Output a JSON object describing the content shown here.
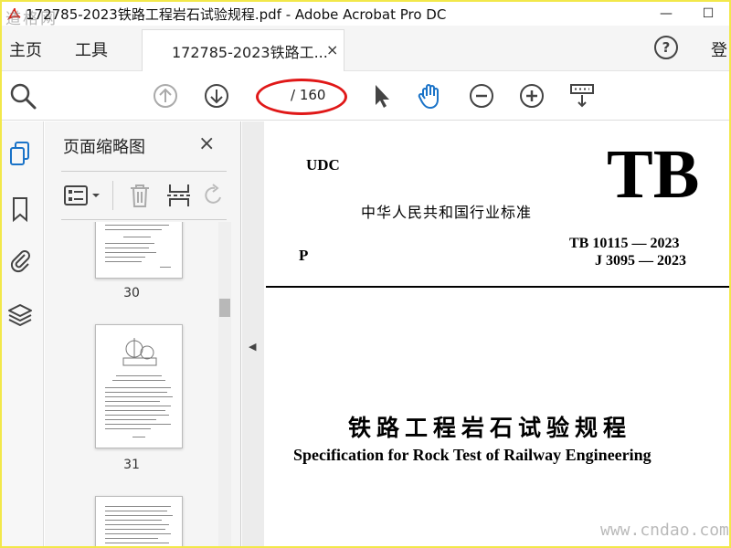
{
  "window": {
    "title": "172785-2023铁路工程岩石试验规程.pdf - Adobe Acrobat Pro DC",
    "watermark_top": "道格网",
    "minimize": "—",
    "maximize": "☐"
  },
  "menubar": {
    "home": "主页",
    "tools": "工具",
    "tab_label": "172785-2023铁路工...",
    "tab_close": "×",
    "help": "?",
    "login": "登"
  },
  "toolbar": {
    "page_current": "",
    "page_total": "/ 160",
    "icons": [
      "search-icon",
      "page-up-icon",
      "page-down-icon",
      "select-arrow-icon",
      "hand-tool-icon",
      "zoom-out-icon",
      "zoom-in-icon",
      "scroll-mode-icon"
    ]
  },
  "thumbnail_panel": {
    "title": "页面缩略图",
    "close": "×",
    "pages": [
      {
        "number": "30"
      },
      {
        "number": "31"
      },
      {
        "number": ""
      }
    ]
  },
  "document": {
    "udc": "UDC",
    "tb": "TB",
    "standard_name": "中华人民共和国行业标准",
    "p_label": "P",
    "code_tb": "TB 10115 — 2023",
    "code_j": "J 3095 — 2023",
    "title_cn": "铁路工程岩石试验规程",
    "title_en": "Specification for Rock Test of Railway Engineering"
  },
  "watermark_bottom": "www.cndao.com",
  "colors": {
    "accent_blue": "#1a73c8",
    "highlight_red": "#e01818",
    "border_yellow": "#f2e84a"
  }
}
